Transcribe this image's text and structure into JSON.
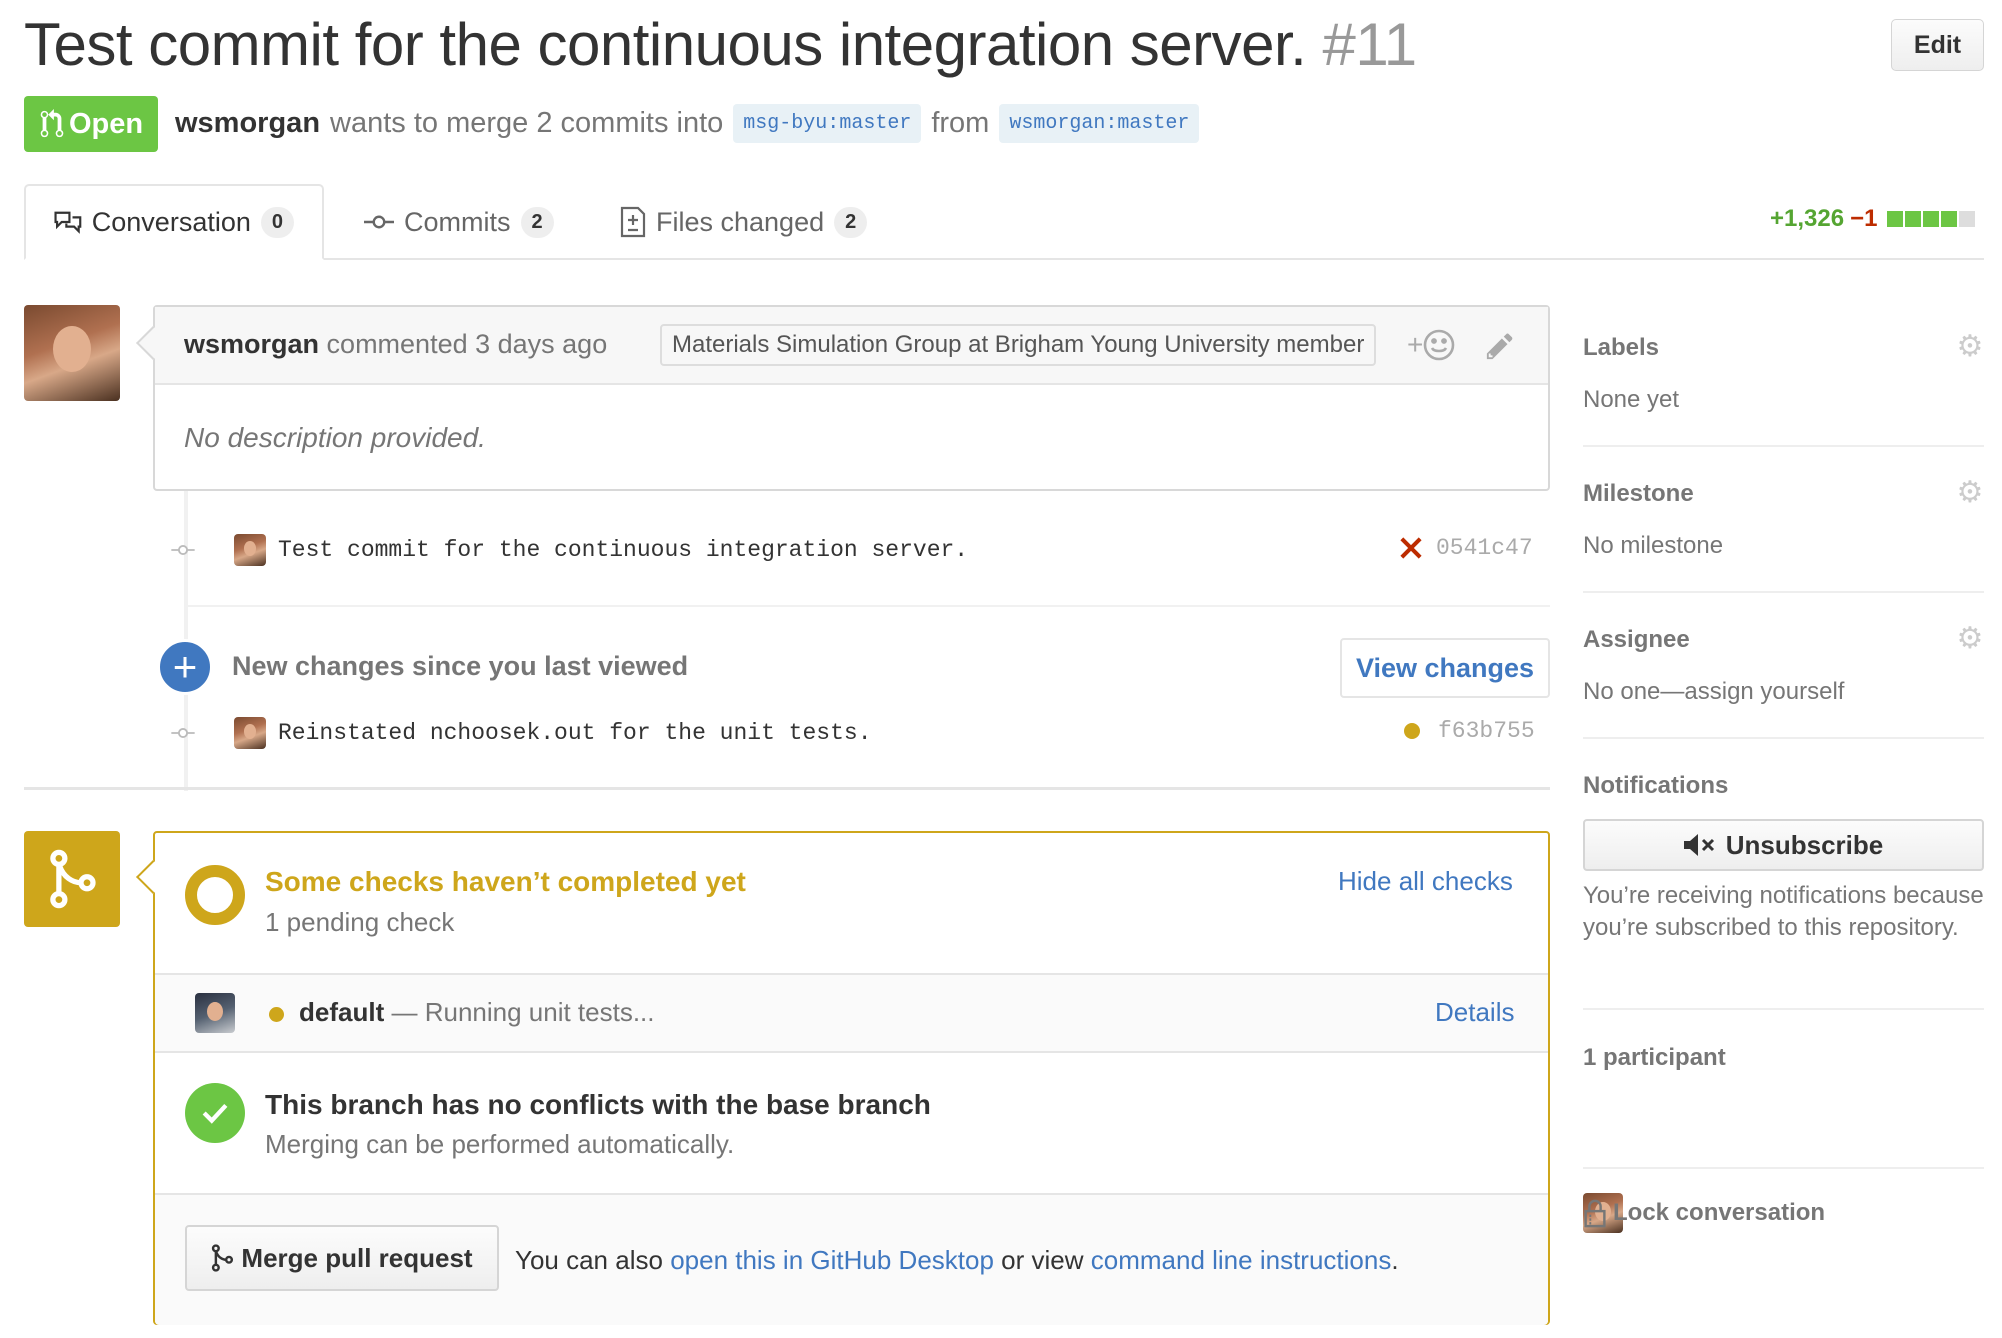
{
  "pr": {
    "title": "Test commit for the continuous integration server.",
    "number": "#11",
    "edit_label": "Edit",
    "state": "Open",
    "author": "wsmorgan",
    "merge_text": "wants to merge 2 commits into",
    "base_branch": "msg-byu:master",
    "from_text": "from",
    "head_branch": "wsmorgan:master"
  },
  "tabs": [
    {
      "label": "Conversation",
      "count": "0",
      "icon": "comment-discussion-icon"
    },
    {
      "label": "Commits",
      "count": "2",
      "icon": "git-commit-icon"
    },
    {
      "label": "Files changed",
      "count": "2",
      "icon": "file-diff-icon"
    }
  ],
  "diffstat": {
    "additions": "+1,326",
    "deletions": "−1",
    "add_color": "#6cc644",
    "del_color": "#bd2c00",
    "neutral_color": "#ddd"
  },
  "comment": {
    "author": "wsmorgan",
    "action": "commented 3 days ago",
    "badge": "Materials Simulation Group at Brigham Young University member",
    "body": "No description provided.",
    "reaction_icon": "smiley-icon",
    "edit_icon": "pencil-icon"
  },
  "commits": [
    {
      "message": "Test commit for the continuous integration server.",
      "sha": "0541c47",
      "status": "failure",
      "status_icon": "x-icon"
    },
    {
      "message": "Reinstated nchoosek.out for the unit tests.",
      "sha": "f63b755",
      "status": "pending",
      "status_icon": "dot-icon"
    }
  ],
  "new_changes": {
    "text": "New changes since you last viewed",
    "button": "View changes"
  },
  "checks": {
    "title": "Some checks haven’t completed yet",
    "subtitle": "1 pending check",
    "hide_label": "Hide all checks",
    "context": "default",
    "dash": "—",
    "description": "Running unit tests...",
    "details_label": "Details",
    "pending_color": "#cea61b"
  },
  "mergeability": {
    "title": "This branch has no conflicts with the base branch",
    "subtitle": "Merging can be performed automatically.",
    "ok_color": "#6cc644"
  },
  "merge": {
    "button": "Merge pull request",
    "note_prefix": "You can also",
    "desktop_link": "open this in GitHub Desktop",
    "note_mid": "or view",
    "cli_link": "command line instructions",
    "note_suffix": "."
  },
  "sidebar": {
    "labels": {
      "heading": "Labels",
      "value": "None yet"
    },
    "milestone": {
      "heading": "Milestone",
      "value": "No milestone"
    },
    "assignee": {
      "heading": "Assignee",
      "value": "No one—assign yourself"
    },
    "notifications": {
      "heading": "Notifications",
      "button": "Unsubscribe",
      "reason": "You’re receiving notifications because you’re subscribed to this repository."
    },
    "participants": {
      "heading": "1 participant"
    },
    "lock": "Lock conversation"
  }
}
